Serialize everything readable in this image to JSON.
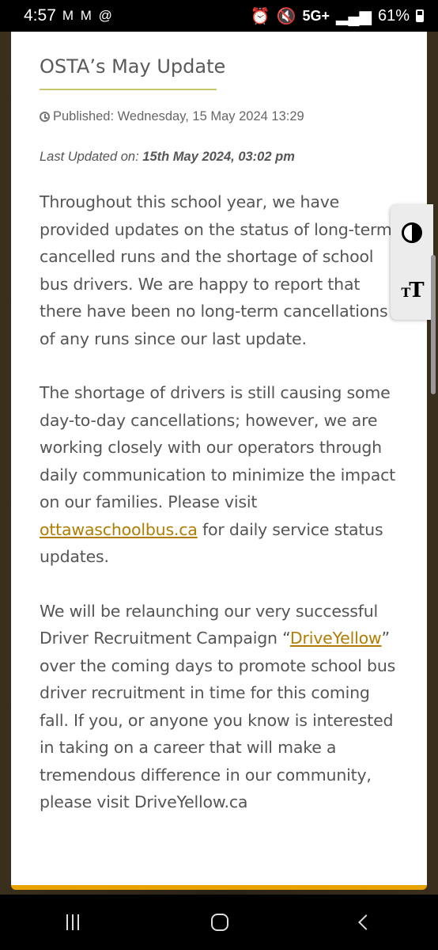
{
  "status_bar": {
    "time": "4:57",
    "notification_icons": "M M @",
    "network": "5G+",
    "battery": "61%"
  },
  "article": {
    "title": "OSTA’s May Update",
    "published": "Published: Wednesday, 15 May 2024 13:29",
    "last_updated_label": "Last Updated on: ",
    "last_updated_value": "15th May 2024, 03:02 pm",
    "para1": "Throughout this school year, we have provided updates on the status of long-term cancelled runs and the shortage of school bus drivers. We are happy to report that there have been no long-term cancellations of any runs since our last update.",
    "para2_before": "The shortage of drivers is still causing some day-to-day cancellations; however, we are working closely with our operators through daily communication to minimize the impact on our families. Please visit ",
    "para2_link": "ottawaschoolbus.ca",
    "para2_after": " for daily service status updates.",
    "para3_before": "We will be relaunching our very successful Driver Recruitment Campaign “",
    "para3_link": "DriveYellow",
    "para3_after": "” over the coming days to promote school bus driver recruitment in time for this coming fall. If you, or anyone you know is interested in taking on a career that will make a tremendous difference in our community, please visit DriveYellow.ca"
  },
  "accessibility": {
    "contrast_icon": "contrast-icon",
    "text_size_icon": "text-size-icon"
  },
  "colors": {
    "link": "#b07d00",
    "accent_bar": "#e8a200",
    "title_underline": "#c9c56a"
  }
}
